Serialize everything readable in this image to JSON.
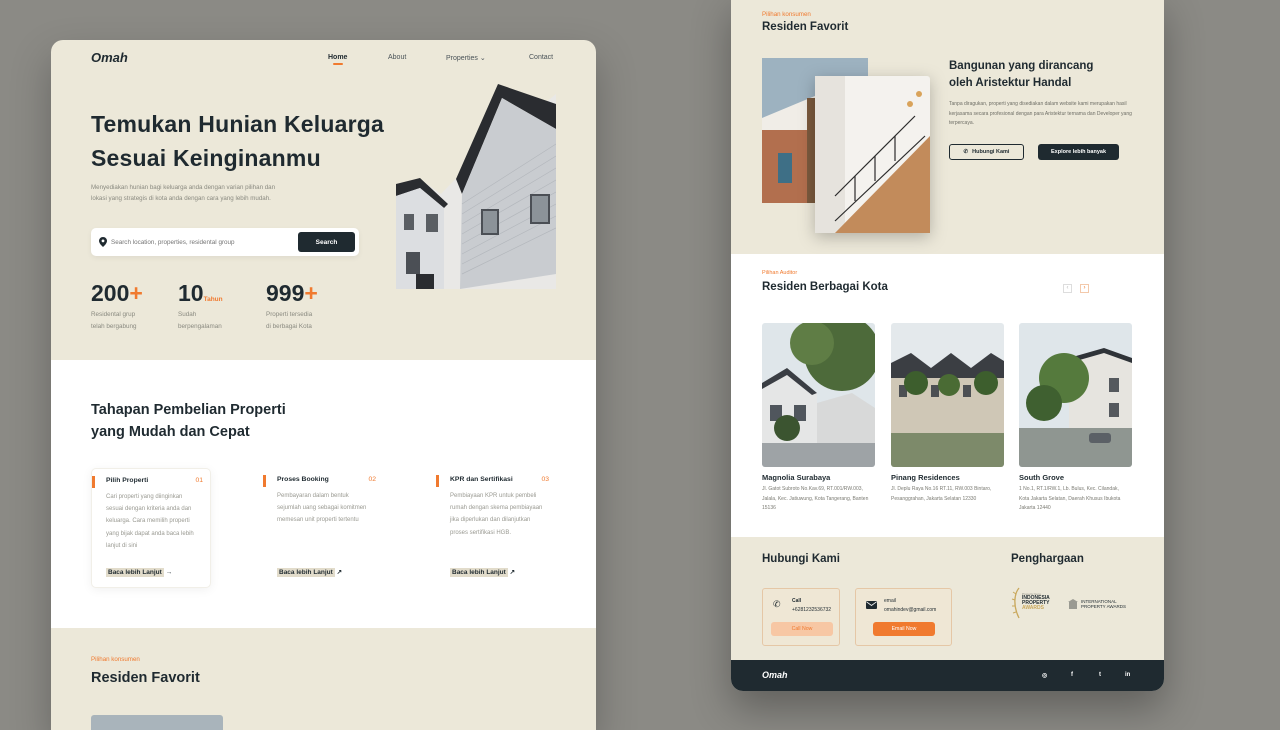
{
  "left_page": {
    "logo": "Omah",
    "nav": {
      "home": "Home",
      "about": "About",
      "properties": "Properties",
      "contact": "Contact"
    },
    "hero": {
      "title_line1": "Temukan Hunian Keluarga",
      "title_line2": "Sesuai Keinginanmu",
      "desc_line1": "Menyediakan hunian bagi keluarga anda dengan varian pilihan dan",
      "desc_line2": "lokasi yang strategis di kota anda dengan cara yang lebih mudah.",
      "search_placeholder": "Search location, properties, residental group",
      "search_button": "Search"
    },
    "stats": [
      {
        "num": "200",
        "suffix": "+",
        "line1": "Residental grup",
        "line2": "telah bergabung"
      },
      {
        "num": "10",
        "suffix": "Tahun",
        "line1": "Sudah",
        "line2": "berpengalaman"
      },
      {
        "num": "999",
        "suffix": "+",
        "line1": "Properti tersedia",
        "line2": "di berbagai Kota"
      }
    ],
    "steps_section": {
      "title_line1": "Tahapan Pembelian Properti",
      "title_line2": "yang Mudah dan Cepat",
      "steps": [
        {
          "title": "Pilih Properti",
          "num": "01",
          "desc": "Cari properti yang diinginkan sesuai dengan kriteria anda dan keluarga. Cara memilih properti yang bijak dapat anda baca lebih lanjut di sini",
          "link": "Baca lebih Lanjut"
        },
        {
          "title": "Proses Booking",
          "num": "02",
          "desc": "Pembayaran dalam bentuk sejumlah uang sebagai komitmen memesan unit properti tertentu",
          "link": "Baca lebih Lanjut"
        },
        {
          "title": "KPR dan Sertifikasi",
          "num": "03",
          "desc": "Pembiayaan KPR untuk pembeli rumah dengan skema pembiayaan jika diperlukan dan dilanjutkan proses sertifikasi HGB.",
          "link": "Baca lebih Lanjut"
        }
      ]
    },
    "favorite": {
      "eyebrow": "Pilihan konsumen",
      "title": "Residen Favorit"
    }
  },
  "right_page": {
    "favorite": {
      "eyebrow": "Pilihan konsumen",
      "title": "Residen Favorit",
      "heading_line1": "Bangunan yang dirancang",
      "heading_line2": "oleh Aristektur Handal",
      "desc": "Tanpa diragukan, properti yang disediakan dalam website kami merupakan hasil kerjasama secara profesional dengan para Aristektur ternama dan Developer yang terpercaya.",
      "btn_contact": "Hubungi Kami",
      "btn_explore": "Explore lebih banyak"
    },
    "cities": {
      "eyebrow": "Pilihan Auditor",
      "title": "Residen Berbagai Kota",
      "prev": "‹",
      "next": "›",
      "items": [
        {
          "name": "Magnolia Surabaya",
          "addr": "Jl. Gatot Subroto No.Kav.69, RT.001/RW.003, Jalala, Kec. Jatiuwung, Kota Tangerang, Banten 15136"
        },
        {
          "name": "Pinang Residences",
          "addr": "Jl. Deplu Raya No.16 RT.11, RW.003 Bintaro, Pesanggrahan, Jakarta Selatan 12330"
        },
        {
          "name": "South Grove",
          "addr": "1 No.1, RT.1/RW.1, Lb. Bulus, Kec. Cilandak, Kota Jakarta Selatan, Daerah Khusus Ibukota Jakarta 12440"
        }
      ]
    },
    "contact": {
      "title": "Hubungi Kami",
      "call_label": "Call",
      "call_value": "+6281232536732",
      "call_btn": "Call Now",
      "email_label": "email",
      "email_value": "omahindev@gmail.com",
      "email_btn": "Email Now"
    },
    "awards": {
      "title": "Penghargaan",
      "award1_small": "Property Guru",
      "award1_line1": "INDONESIA",
      "award1_line2": "PROPERTY",
      "award1_line3": "AWARDS",
      "award2_line1": "INTERNATIONAL",
      "award2_line2": "PROPERTY AWARDS"
    },
    "footer": {
      "logo": "Omah",
      "social": [
        "◎",
        "f",
        "t",
        "in"
      ]
    }
  },
  "colors": {
    "accent": "#f07a2f",
    "dark": "#1f2a30",
    "cream": "#ece8d9",
    "bg": "#8b8a85"
  }
}
